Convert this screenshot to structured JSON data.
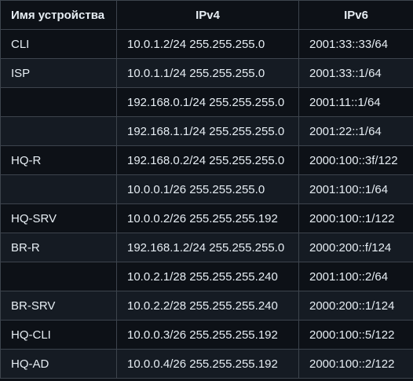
{
  "table": {
    "headers": {
      "device": "Имя устройства",
      "ipv4": "IPv4",
      "ipv6": "IPv6"
    },
    "rows": [
      {
        "device": "CLI",
        "ipv4": "10.0.1.2/24 255.255.255.0",
        "ipv6": "2001:33::33/64"
      },
      {
        "device": "ISP",
        "ipv4": "10.0.1.1/24 255.255.255.0",
        "ipv6": "2001:33::1/64"
      },
      {
        "device": "",
        "ipv4": "192.168.0.1/24 255.255.255.0",
        "ipv6": "2001:11::1/64"
      },
      {
        "device": "",
        "ipv4": "192.168.1.1/24 255.255.255.0",
        "ipv6": "2001:22::1/64"
      },
      {
        "device": "HQ-R",
        "ipv4": "192.168.0.2/24 255.255.255.0",
        "ipv6": "2000:100::3f/122"
      },
      {
        "device": "",
        "ipv4": "10.0.0.1/26 255.255.255.0",
        "ipv6": "2001:100::1/64"
      },
      {
        "device": "HQ-SRV",
        "ipv4": "10.0.0.2/26 255.255.255.192",
        "ipv6": "2000:100::1/122"
      },
      {
        "device": "BR-R",
        "ipv4": "192.168.1.2/24 255.255.255.0",
        "ipv6": "2000:200::f/124"
      },
      {
        "device": "",
        "ipv4": "10.0.2.1/28 255.255.255.240",
        "ipv6": "2001:100::2/64"
      },
      {
        "device": "BR-SRV",
        "ipv4": "10.0.2.2/28 255.255.255.240",
        "ipv6": "2000:200::1/124"
      },
      {
        "device": "HQ-CLI",
        "ipv4": "10.0.0.3/26 255.255.255.192",
        "ipv6": "2000:100::5/122"
      },
      {
        "device": "HQ-AD",
        "ipv4": "10.0.0.4/26 255.255.255.192",
        "ipv6": "2000:100::2/122"
      }
    ]
  }
}
